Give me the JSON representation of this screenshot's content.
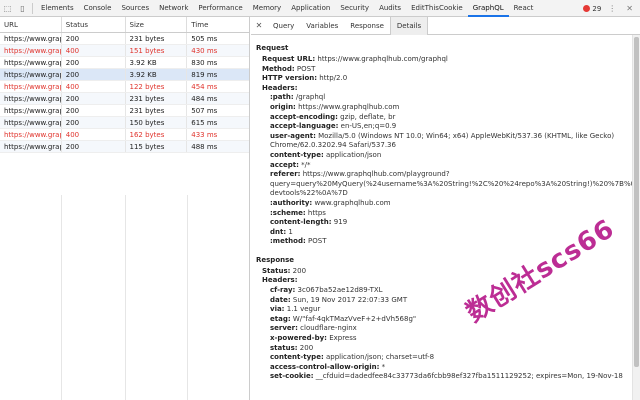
{
  "devtools": {
    "tabs": [
      "Elements",
      "Console",
      "Sources",
      "Network",
      "Performance",
      "Memory",
      "Application",
      "Security",
      "Audits",
      "EditThisCookie",
      "GraphQL",
      "React"
    ],
    "active_tab": "GraphQL",
    "error_count": "29"
  },
  "network": {
    "columns": [
      "URL",
      "Status",
      "Size",
      "Time"
    ],
    "rows": [
      {
        "url": "https://www.grap...",
        "status": "200",
        "size": "231 bytes",
        "time": "505 ms",
        "error": false
      },
      {
        "url": "https://www.grap...",
        "status": "400",
        "size": "151 bytes",
        "time": "430 ms",
        "error": true
      },
      {
        "url": "https://www.grap...",
        "status": "200",
        "size": "3.92 KB",
        "time": "830 ms",
        "error": false
      },
      {
        "url": "https://www.grap...",
        "status": "200",
        "size": "3.92 KB",
        "time": "819 ms",
        "error": false,
        "selected": true
      },
      {
        "url": "https://www.grap...",
        "status": "400",
        "size": "122 bytes",
        "time": "454 ms",
        "error": true
      },
      {
        "url": "https://www.grap...",
        "status": "200",
        "size": "231 bytes",
        "time": "484 ms",
        "error": false
      },
      {
        "url": "https://www.grap...",
        "status": "200",
        "size": "231 bytes",
        "time": "507 ms",
        "error": false
      },
      {
        "url": "https://www.grap...",
        "status": "200",
        "size": "150 bytes",
        "time": "615 ms",
        "error": false
      },
      {
        "url": "https://www.grap...",
        "status": "400",
        "size": "162 bytes",
        "time": "433 ms",
        "error": true
      },
      {
        "url": "https://www.grap...",
        "status": "200",
        "size": "115 bytes",
        "time": "488 ms",
        "error": false
      }
    ]
  },
  "details_tabs": [
    "Query",
    "Variables",
    "Response",
    "Details"
  ],
  "active_details_tab": "Details",
  "request": {
    "title": "Request",
    "url_key": "Request URL:",
    "url": "https://www.graphqlhub.com/graphql",
    "method_key": "Method:",
    "method": "POST",
    "http_key": "HTTP version:",
    "http": "http/2.0",
    "headers_key": "Headers:",
    "headers": [
      {
        "k": ":path:",
        "v": "/graphql"
      },
      {
        "k": "origin:",
        "v": "https://www.graphqlhub.com"
      },
      {
        "k": "accept-encoding:",
        "v": "gzip, deflate, br"
      },
      {
        "k": "accept-language:",
        "v": "en-US,en;q=0.9"
      },
      {
        "k": "user-agent:",
        "v": "Mozilla/5.0 (Windows NT 10.0; Win64; x64) AppleWebKit/537.36 (KHTML, like Gecko)"
      },
      {
        "k": "",
        "v": "Chrome/62.0.3202.94 Safari/537.36"
      },
      {
        "k": "content-type:",
        "v": "application/json"
      },
      {
        "k": "accept:",
        "v": "*/*"
      },
      {
        "k": "referer:",
        "v": "https://www.graphqlhub.com/playground?"
      },
      {
        "k": "",
        "v": "query=query%20MyQuery(%24username%3A%20String!%2C%20%24repo%3A%20String!)%20%7B%0A%"
      },
      {
        "k": "",
        "v": "devtools%22%0A%7D"
      },
      {
        "k": ":authority:",
        "v": "www.graphqlhub.com"
      },
      {
        "k": ":scheme:",
        "v": "https"
      },
      {
        "k": "content-length:",
        "v": "919"
      },
      {
        "k": "dnt:",
        "v": "1"
      },
      {
        "k": ":method:",
        "v": "POST"
      }
    ]
  },
  "response": {
    "title": "Response",
    "status_key": "Status:",
    "status": "200",
    "headers_key": "Headers:",
    "headers": [
      {
        "k": "cf-ray:",
        "v": "3c067ba52ae12d89-TXL"
      },
      {
        "k": "date:",
        "v": "Sun, 19 Nov 2017 22:07:33 GMT"
      },
      {
        "k": "via:",
        "v": "1.1 vegur"
      },
      {
        "k": "etag:",
        "v": "W/\"faf-4qkTMazVveF+2+dVh568g\""
      },
      {
        "k": "server:",
        "v": "cloudflare-nginx"
      },
      {
        "k": "x-powered-by:",
        "v": "Express"
      },
      {
        "k": "status:",
        "v": "200"
      },
      {
        "k": "content-type:",
        "v": "application/json; charset=utf-8"
      },
      {
        "k": "access-control-allow-origin:",
        "v": "*"
      },
      {
        "k": "set-cookie:",
        "v": "__cfduid=dadedfee84c33773da6fcbb98ef327fba1511129252; expires=Mon, 19-Nov-18"
      }
    ]
  },
  "watermark": "数创社scs66"
}
